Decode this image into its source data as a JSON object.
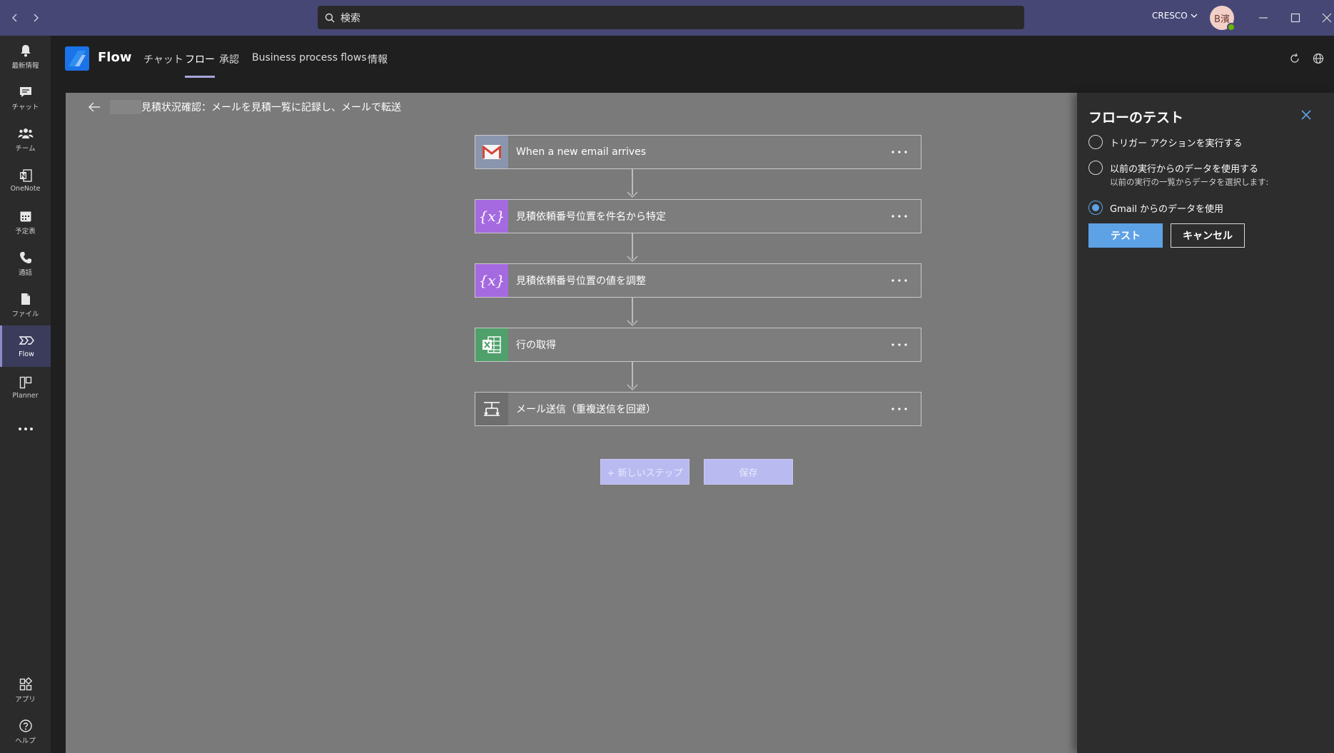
{
  "titlebar": {
    "search_placeholder": "検索",
    "org_name": "CRESCO",
    "avatar_initials": "B濱"
  },
  "rail": {
    "items": [
      {
        "label": "最新情報",
        "icon": "bell-icon"
      },
      {
        "label": "チャット",
        "icon": "chat-icon"
      },
      {
        "label": "チーム",
        "icon": "teams-icon"
      },
      {
        "label": "OneNote",
        "icon": "onenote-icon"
      },
      {
        "label": "予定表",
        "icon": "calendar-icon"
      },
      {
        "label": "通話",
        "icon": "phone-icon"
      },
      {
        "label": "ファイル",
        "icon": "file-icon"
      },
      {
        "label": "Flow",
        "icon": "flow-icon"
      },
      {
        "label": "Planner",
        "icon": "planner-icon"
      }
    ],
    "bottom": [
      {
        "label": "アプリ",
        "icon": "apps-icon"
      },
      {
        "label": "ヘルプ",
        "icon": "help-icon"
      }
    ]
  },
  "header": {
    "app_name": "Flow",
    "tabs": [
      {
        "label": "チャット"
      },
      {
        "label": "フロー"
      },
      {
        "label": "承認"
      },
      {
        "label": "Business process flows"
      },
      {
        "label": "情報"
      }
    ],
    "active_tab": "フロー"
  },
  "canvas": {
    "flow_title": "見積状況確認：メールを見積一覧に記録し、メールで転送",
    "steps": [
      {
        "label": "When a new email arrives",
        "icon": "gmail-icon",
        "color": "#8a96ad"
      },
      {
        "label": "見積依頼番号位置を件名から特定",
        "icon": "variable-icon",
        "color": "#a56ae0"
      },
      {
        "label": "見積依頼番号位置の値を調整",
        "icon": "variable-icon",
        "color": "#a56ae0"
      },
      {
        "label": "行の取得",
        "icon": "excel-icon",
        "color": "#50a06b"
      },
      {
        "label": "メール送信（重複送信を回避）",
        "icon": "condition-icon",
        "color": "#6e6e6e"
      }
    ],
    "new_step_label": "+ 新しいステップ",
    "save_label": "保存"
  },
  "panel": {
    "title": "フローのテスト",
    "options": [
      {
        "label": "トリガー アクションを実行する",
        "checked": false
      },
      {
        "label": "以前の実行からのデータを使用する",
        "checked": false,
        "sub": "以前の実行の一覧からデータを選択します:"
      },
      {
        "label": "Gmail からのデータを使用",
        "checked": true
      }
    ],
    "test_label": "テスト",
    "cancel_label": "キャンセル"
  },
  "colors": {
    "titlebar": "#464775",
    "canvas": "#7a7a7a",
    "panel": "#2d2d2d",
    "accent": "#5ea2e6"
  }
}
